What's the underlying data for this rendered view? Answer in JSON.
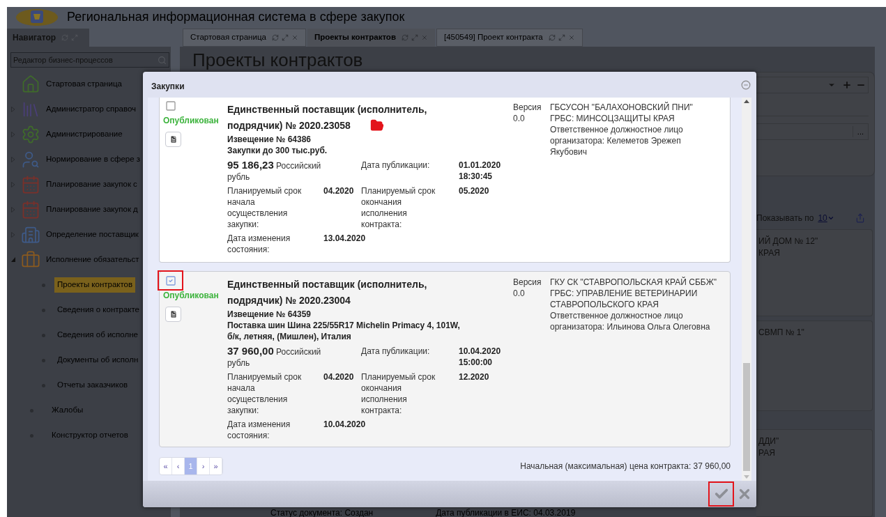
{
  "header": {
    "title": "Региональная информационная система в сфере закупок"
  },
  "navigator": {
    "title": "Навигатор",
    "search": {
      "value": "Редактор бизнес-процессов"
    },
    "items": [
      {
        "label": "Стартовая страница",
        "kind": "link"
      },
      {
        "label": "Администратор справоч",
        "kind": "folder",
        "expanded": false
      },
      {
        "label": "Администрирование",
        "kind": "folder",
        "expanded": false
      },
      {
        "label": "Нормирование в сфере з",
        "kind": "folder",
        "expanded": false
      },
      {
        "label": "Планирование закупок с",
        "kind": "folder",
        "expanded": false
      },
      {
        "label": "Планирование закупок д",
        "kind": "folder",
        "expanded": false
      },
      {
        "label": "Определение поставщик",
        "kind": "folder",
        "expanded": false
      },
      {
        "label": "Исполнение обязательст",
        "kind": "folder",
        "expanded": true,
        "children": [
          {
            "label": "Проекты контрактов",
            "selected": true
          },
          {
            "label": "Сведения о контракте",
            "selected": false
          },
          {
            "label": "Сведения об исполне",
            "selected": false
          },
          {
            "label": "Документы об исполн",
            "selected": false
          },
          {
            "label": "Отчеты заказчиков",
            "selected": false
          }
        ]
      },
      {
        "label": "Жалобы",
        "kind": "bullet"
      },
      {
        "label": "Конструктор отчетов",
        "kind": "bullet"
      }
    ]
  },
  "tabs": [
    {
      "label": "Стартовая страница",
      "selected": false
    },
    {
      "label": "Проекты контрактов",
      "selected": true
    },
    {
      "label": "[450549] Проект контракта",
      "selected": false
    }
  ],
  "page": {
    "title": "Проекты контрактов",
    "browse_label": "...",
    "page_size_label": "Показывать по",
    "page_size": "10",
    "cards": [
      {
        "lines": [
          "ИЙ ДОМ № 12\"",
          "КРАЯ"
        ]
      },
      {
        "lines": [
          "СВМП № 1\""
        ]
      },
      {
        "lines": [
          "ДДИ\"",
          "РАЯ"
        ]
      }
    ],
    "footer": [
      "Статус документа: Создан",
      "Дата публикации в ЕИС: 04.03.2019"
    ]
  },
  "modal": {
    "title": "Закупки",
    "items": [
      {
        "checked": false,
        "highlighted": false,
        "status": "Опубликован",
        "title": "Единственный поставщик (исполнитель, подрядчик) № 2020.23058",
        "folder_icon": true,
        "notice": "Извещение № 64386",
        "subject": "Закупки до 300 тыс.руб.",
        "amount": "95 186,23",
        "currency": "Российский рубль",
        "fields": [
          {
            "label": "Дата публикации:",
            "value": "01.01.2020 18:30:45"
          },
          {
            "label": "Планируемый срок начала осуществления закупки:",
            "value": "04.2020"
          },
          {
            "label": "Планируемый срок окончания исполнения контракта:",
            "value": "05.2020"
          },
          {
            "label": "Дата изменения состояния:",
            "value": "13.04.2020"
          }
        ],
        "version_label": "Версия",
        "version": "0.0",
        "org": [
          "ГБСУСОН \"БАЛАХОНОВСКИЙ ПНИ\"",
          "ГРБС: МИНСОЦЗАЩИТЫ КРАЯ",
          "Ответственное должностное лицо организатора: Келеметов Эрежеп Якубович"
        ]
      },
      {
        "checked": true,
        "highlighted": true,
        "status": "Опубликован",
        "title": "Единственный поставщик (исполнитель, подрядчик) № 2020.23004",
        "folder_icon": false,
        "notice": "Извещение № 64359",
        "subject": "Поставка шин Шина 225/55R17 Michelin Primacy 4, 101W, б/к, летняя, (Мишлен), Италия",
        "amount": "37 960,00",
        "currency": "Российский рубль",
        "fields": [
          {
            "label": "Дата публикации:",
            "value": "10.04.2020 15:00:00"
          },
          {
            "label": "Планируемый срок начала осуществления закупки:",
            "value": "04.2020"
          },
          {
            "label": "Планируемый срок окончания исполнения контракта:",
            "value": "12.2020"
          },
          {
            "label": "Дата изменения состояния:",
            "value": "10.04.2020"
          }
        ],
        "version_label": "Версия",
        "version": "0.0",
        "org": [
          "ГКУ СК \"СТАВРОПОЛЬСКАЯ КРАЙ СББЖ\"",
          "ГРБС: УПРАВЛЕНИЕ ВЕТЕРИНАРИИ СТАВРОПОЛЬСКОГО КРАЯ",
          "Ответственное должностное лицо организатора: Ильинова Ольга Олеговна"
        ]
      }
    ],
    "pagination": [
      {
        "label": "«",
        "selected": false
      },
      {
        "label": "‹",
        "selected": false
      },
      {
        "label": "1",
        "selected": true
      },
      {
        "label": "›",
        "selected": false
      },
      {
        "label": "»",
        "selected": false
      }
    ],
    "total": "Начальная (максимальная) цена контракта: 37 960,00",
    "confirm": {
      "highlighted": true
    }
  }
}
